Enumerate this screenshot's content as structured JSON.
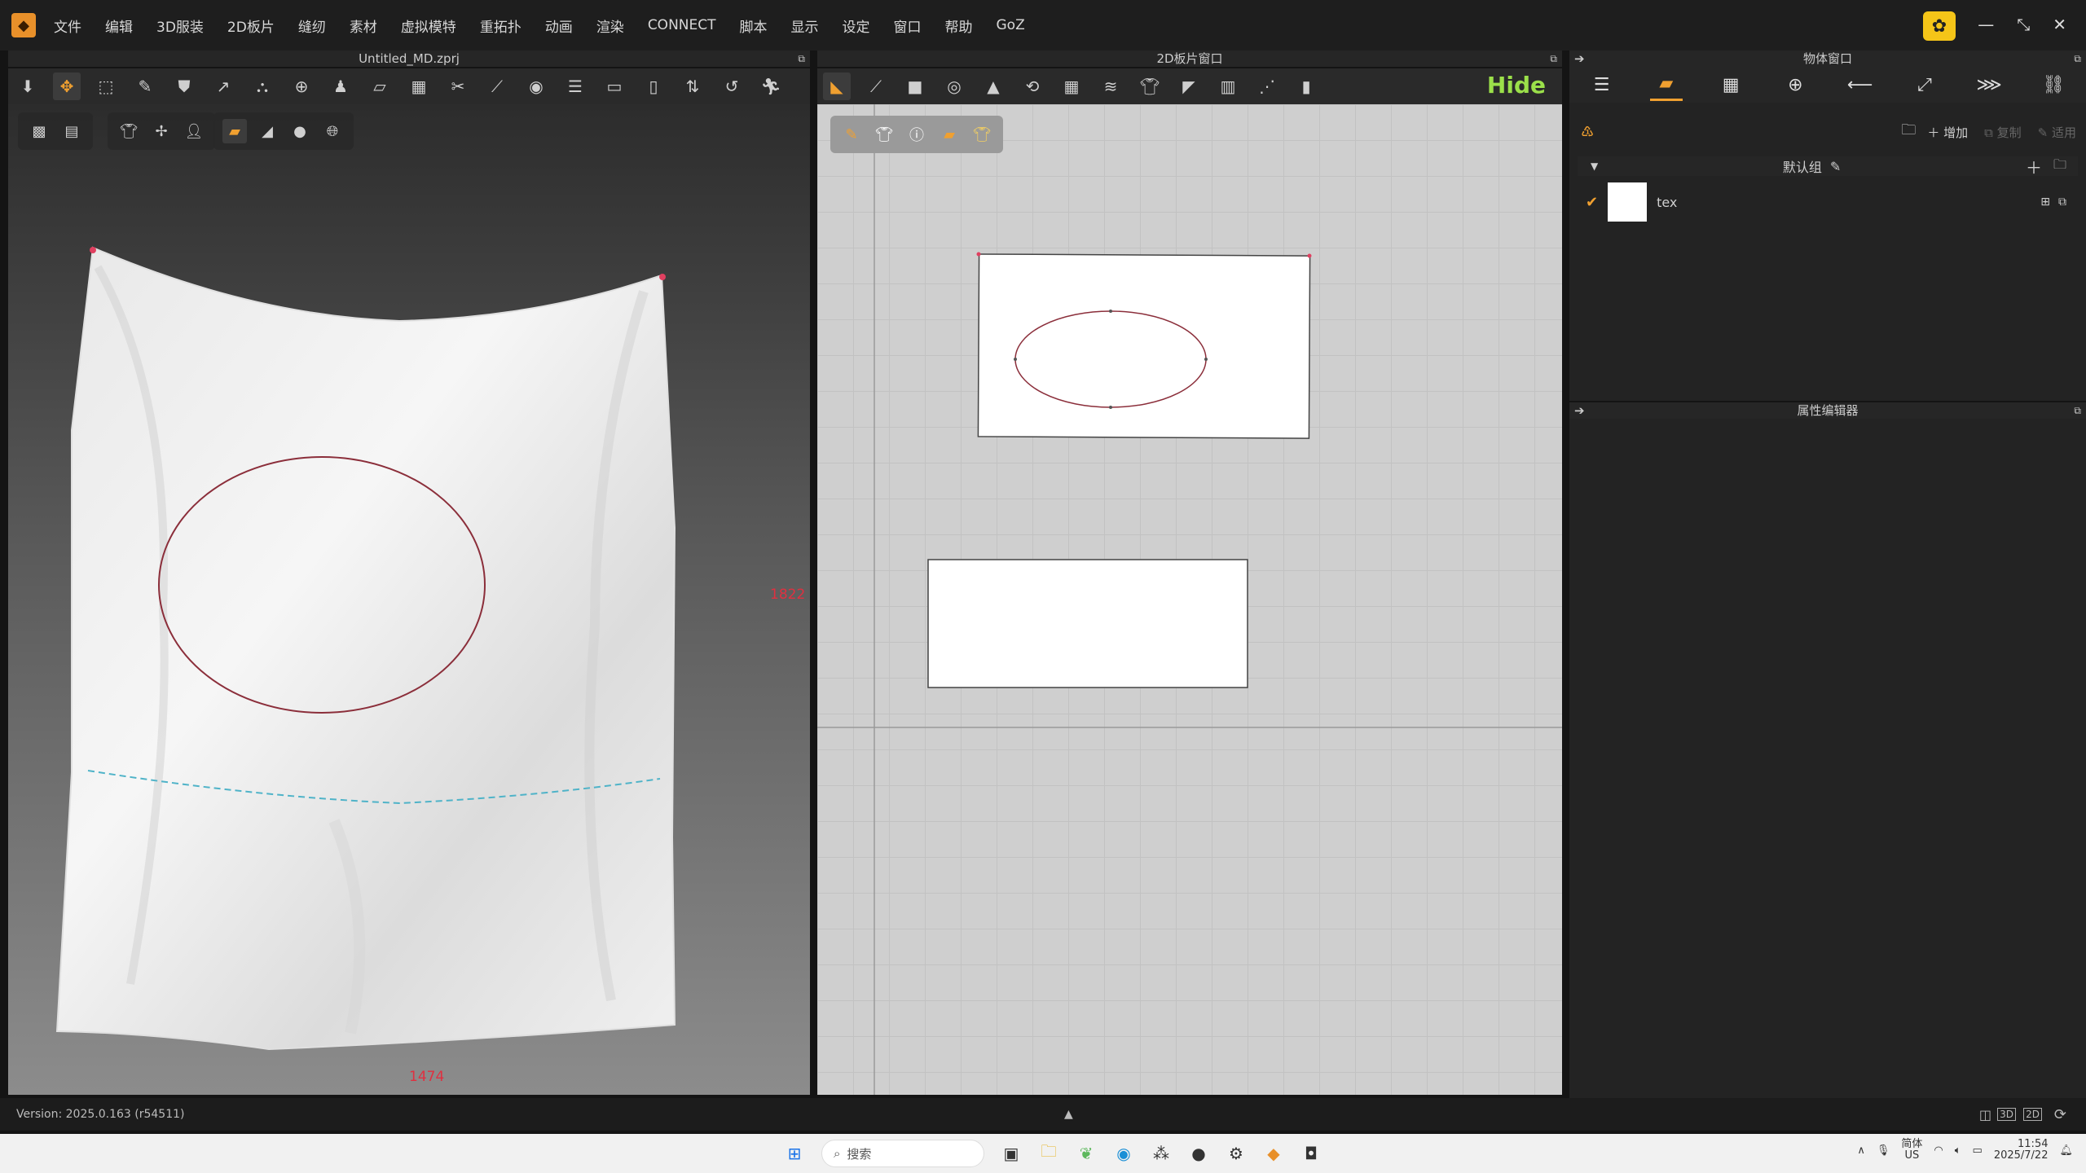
{
  "menubar": {
    "items": [
      "文件",
      "编辑",
      "3D服装",
      "2D板片",
      "缝纫",
      "素材",
      "虚拟模特",
      "重拓扑",
      "动画",
      "渲染",
      "CONNECT",
      "脚本",
      "显示",
      "设定",
      "窗口",
      "帮助",
      "GoZ"
    ],
    "window_controls": [
      "—",
      "⤡",
      "✕"
    ]
  },
  "viewport3d": {
    "title": "Untitled_MD.zprj",
    "dimension_height": "1822",
    "dimension_width": "1474",
    "colors": {
      "outline": "#8b2e3a",
      "seam": "#4fb3c8"
    }
  },
  "viewport2d": {
    "title": "2D板片窗口",
    "hide_label": "Hide"
  },
  "object_window": {
    "title": "物体窗口",
    "add_label": "增加",
    "copy_label": "复制",
    "apply_label": "适用",
    "group_name": "默认组",
    "material_name": "tex"
  },
  "property_editor": {
    "title": "属性编辑器"
  },
  "status": {
    "version": "Version: 2025.0.163 (r54511)"
  },
  "taskbar": {
    "search_placeholder": "搜索",
    "ime_label": "简体",
    "locale": "US",
    "time": "11:54",
    "date": "2025/7/22"
  },
  "colors": {
    "accent": "#f0a030",
    "hide_green": "#9be04a",
    "fabric": "#f2f2f2"
  }
}
